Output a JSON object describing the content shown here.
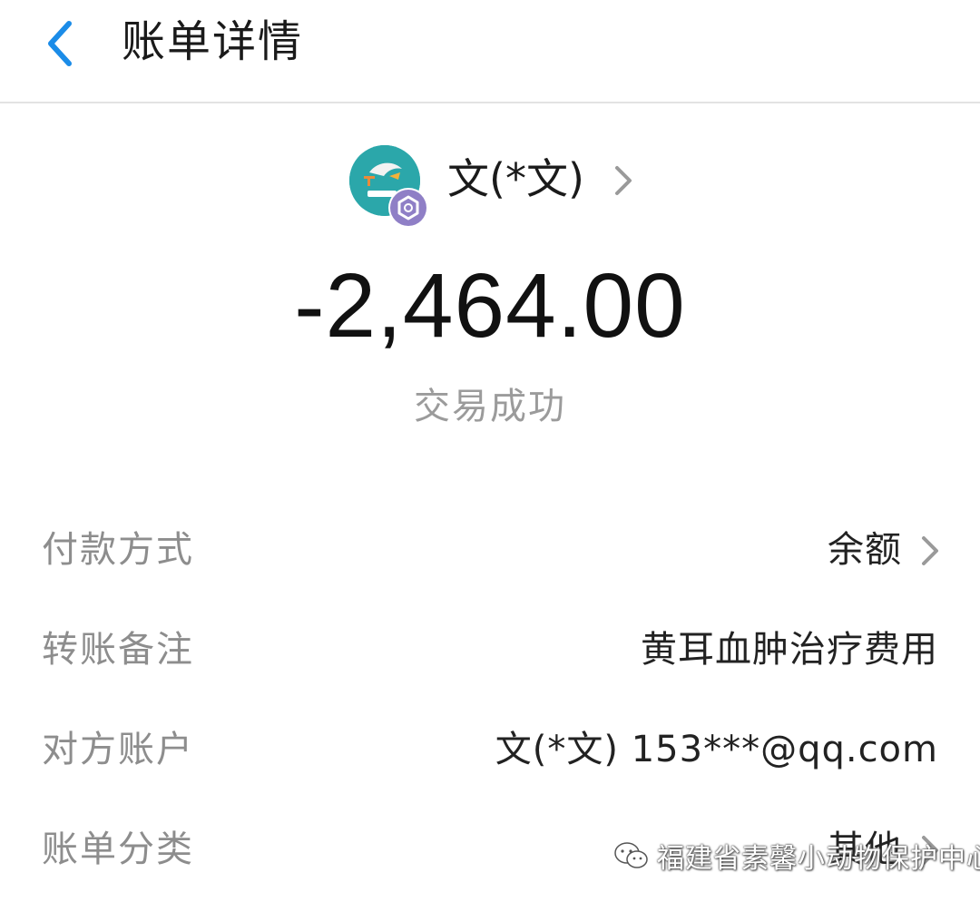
{
  "header": {
    "title": "账单详情"
  },
  "payee": {
    "name": "文(*文)"
  },
  "amount": "-2,464.00",
  "status": "交易成功",
  "rows": [
    {
      "label": "付款方式",
      "value": "余额"
    },
    {
      "label": "转账备注",
      "value": "黄耳血肿治疗费用"
    },
    {
      "label": "对方账户",
      "value": "文(*文) 153***@qq.com"
    },
    {
      "label": "账单分类",
      "value": "其他"
    }
  ],
  "watermark": {
    "text": "福建省素馨小动物保护中心"
  },
  "colors": {
    "accent": "#1b8ce8",
    "label_gray": "#8d8d8d",
    "status_gray": "#9b9b9b"
  },
  "icons": {
    "back": "chevron-left-icon",
    "chevron": "chevron-right-icon",
    "badge": "verified-badge-icon",
    "wechat": "wechat-icon"
  }
}
